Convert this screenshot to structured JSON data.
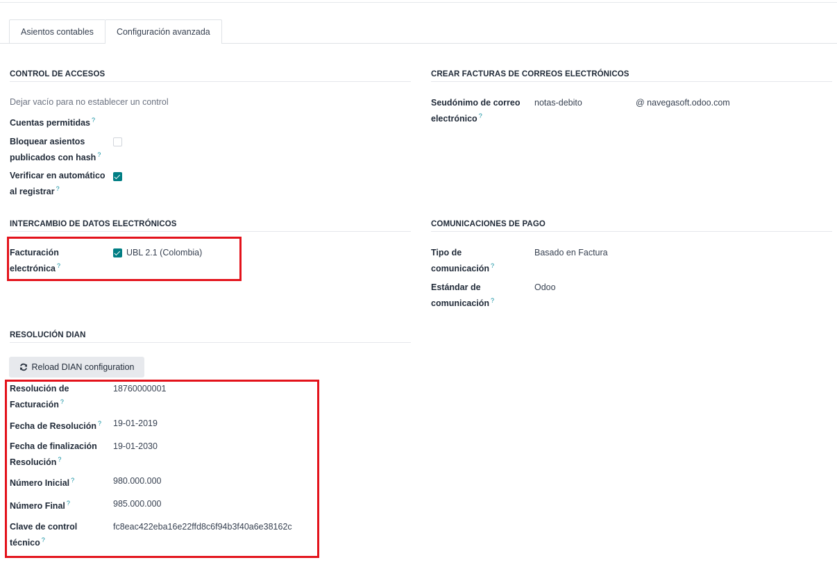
{
  "tabs": [
    {
      "label": "Asientos contables",
      "active": false
    },
    {
      "label": "Configuración avanzada",
      "active": true
    }
  ],
  "access_control": {
    "title": "CONTROL DE ACCESOS",
    "hint": "Dejar vacío para no establecer un control",
    "allowed_accounts_label": "Cuentas permitidas",
    "lock_hash_label_1": "Bloquear asientos",
    "lock_hash_label_2": "publicados con hash",
    "lock_hash_checked": false,
    "auto_verify_label_1": "Verificar en automático",
    "auto_verify_label_2": "al registrar",
    "auto_verify_checked": true
  },
  "email_invoices": {
    "title": "CREAR FACTURAS DE CORREOS ELECTRÓNICOS",
    "alias_label_1": "Seudónimo de correo",
    "alias_label_2": "electrónico",
    "alias_value": "notas-debito",
    "alias_domain": "@ navegasoft.odoo.com"
  },
  "edi": {
    "title": "INTERCAMBIO DE DATOS ELECTRÓNICOS",
    "einvoice_label_1": "Facturación",
    "einvoice_label_2": "electrónica",
    "format_label": "UBL 2.1 (Colombia)",
    "format_checked": true
  },
  "payment_comm": {
    "title": "COMUNICACIONES DE PAGO",
    "type_label_1": "Tipo de",
    "type_label_2": "comunicación",
    "type_value": "Basado en Factura",
    "standard_label_1": "Estándar de",
    "standard_label_2": "comunicación",
    "standard_value": "Odoo"
  },
  "dian": {
    "title": "RESOLUCIÓN DIAN",
    "reload_button": "Reload DIAN configuration",
    "resolution_label_1": "Resolución de",
    "resolution_label_2": "Facturación",
    "resolution_value": "18760000001",
    "date_label": "Fecha de Resolución",
    "date_value": "19-01-2019",
    "end_label_1": "Fecha de finalización",
    "end_label_2": "Resolución",
    "end_value": "19-01-2030",
    "start_num_label": "Número Inicial",
    "start_num_value": "980.000.000",
    "end_num_label": "Número Final",
    "end_num_value": "985.000.000",
    "key_label_1": "Clave de control",
    "key_label_2": "técnico",
    "key_value": "fc8eac422eba16e22ffd8c6f94b3f40a6e38162c"
  },
  "help_mark": "?",
  "colors": {
    "accent": "#017e84",
    "help": "#0d8ea0",
    "highlight": "#e3121b"
  }
}
